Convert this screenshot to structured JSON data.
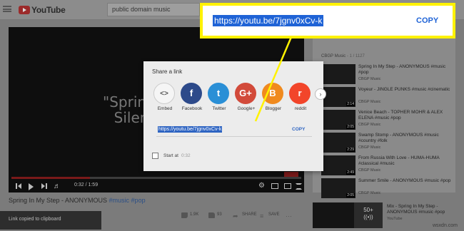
{
  "header": {
    "logo_text": "YouTube",
    "search_value": "public domain music"
  },
  "video": {
    "overlay_text": "\"Spring\n Silen",
    "time": "0:32 / 1:59",
    "progress_fraction": 0.27,
    "title_prefix": "Spring In My Step - ANONYMOUS ",
    "title_tags": "#music #pop"
  },
  "actions": {
    "like_count": "1.9K",
    "dislike_count": "93",
    "share_label": "SHARE",
    "save_label": "SAVE"
  },
  "snackbar": {
    "text": "Link copied to clipboard"
  },
  "sidebar": {
    "channel": "CBGP Music",
    "count": " - 1 / 1127",
    "items": [
      {
        "title": "Spring In My Step - ANONYMOUS #music #pop",
        "channel": "CBGP Music",
        "duration": ""
      },
      {
        "title": "Voyeur - JINGLE PUNKS #music #cinematic",
        "channel": "CBGP Music",
        "duration": "2:14"
      },
      {
        "title": "Venice Beach - TOPHER MOHR & ALEX ELENA #music #pop",
        "channel": "CBGP Music",
        "duration": "2:05"
      },
      {
        "title": "Swamp Stomp - ANONYMOUS #music #country #folk",
        "channel": "CBGP Music",
        "duration": "2:29"
      },
      {
        "title": "From Russia With Love - HUMA-HUMA #classical #music",
        "channel": "CBGP Music",
        "duration": "2:49"
      },
      {
        "title": "Summer Smile - ANONYMOUS #music #pop",
        "channel": "CBGP Music",
        "duration": "2:05"
      }
    ],
    "mix": {
      "title": "Mix - Spring In My Step - ANONYMOUS #music #pop",
      "channel": "YouTube",
      "overlay_count": "50+",
      "overlay_icon": "((•))"
    }
  },
  "share_dialog": {
    "title": "Share a link",
    "services": [
      {
        "label": "Embed",
        "glyph": "<>",
        "color": "#f5f5f5",
        "icon": "embed-icon"
      },
      {
        "label": "Facebook",
        "glyph": "f",
        "color": "#2d4a8a",
        "icon": "facebook-icon"
      },
      {
        "label": "Twitter",
        "glyph": "t",
        "color": "#2a8fd6",
        "icon": "twitter-icon"
      },
      {
        "label": "Google+",
        "glyph": "G+",
        "color": "#d24a3a",
        "icon": "google-plus-icon"
      },
      {
        "label": "Blogger",
        "glyph": "B",
        "color": "#f08a1e",
        "icon": "blogger-icon"
      },
      {
        "label": "reddit",
        "glyph": "r",
        "color": "#f2452a",
        "icon": "reddit-icon"
      }
    ],
    "url": "https://youtu.be/7jgnv0xCv-k",
    "copy_label": "COPY",
    "start_at_label": "Start at",
    "start_at_time": "0:32"
  },
  "callout": {
    "url": "https://youtu.be/7jgnv0xCv-k",
    "copy_label": "COPY",
    "border_color": "#fff200"
  },
  "watermark": "wsxdn.com"
}
